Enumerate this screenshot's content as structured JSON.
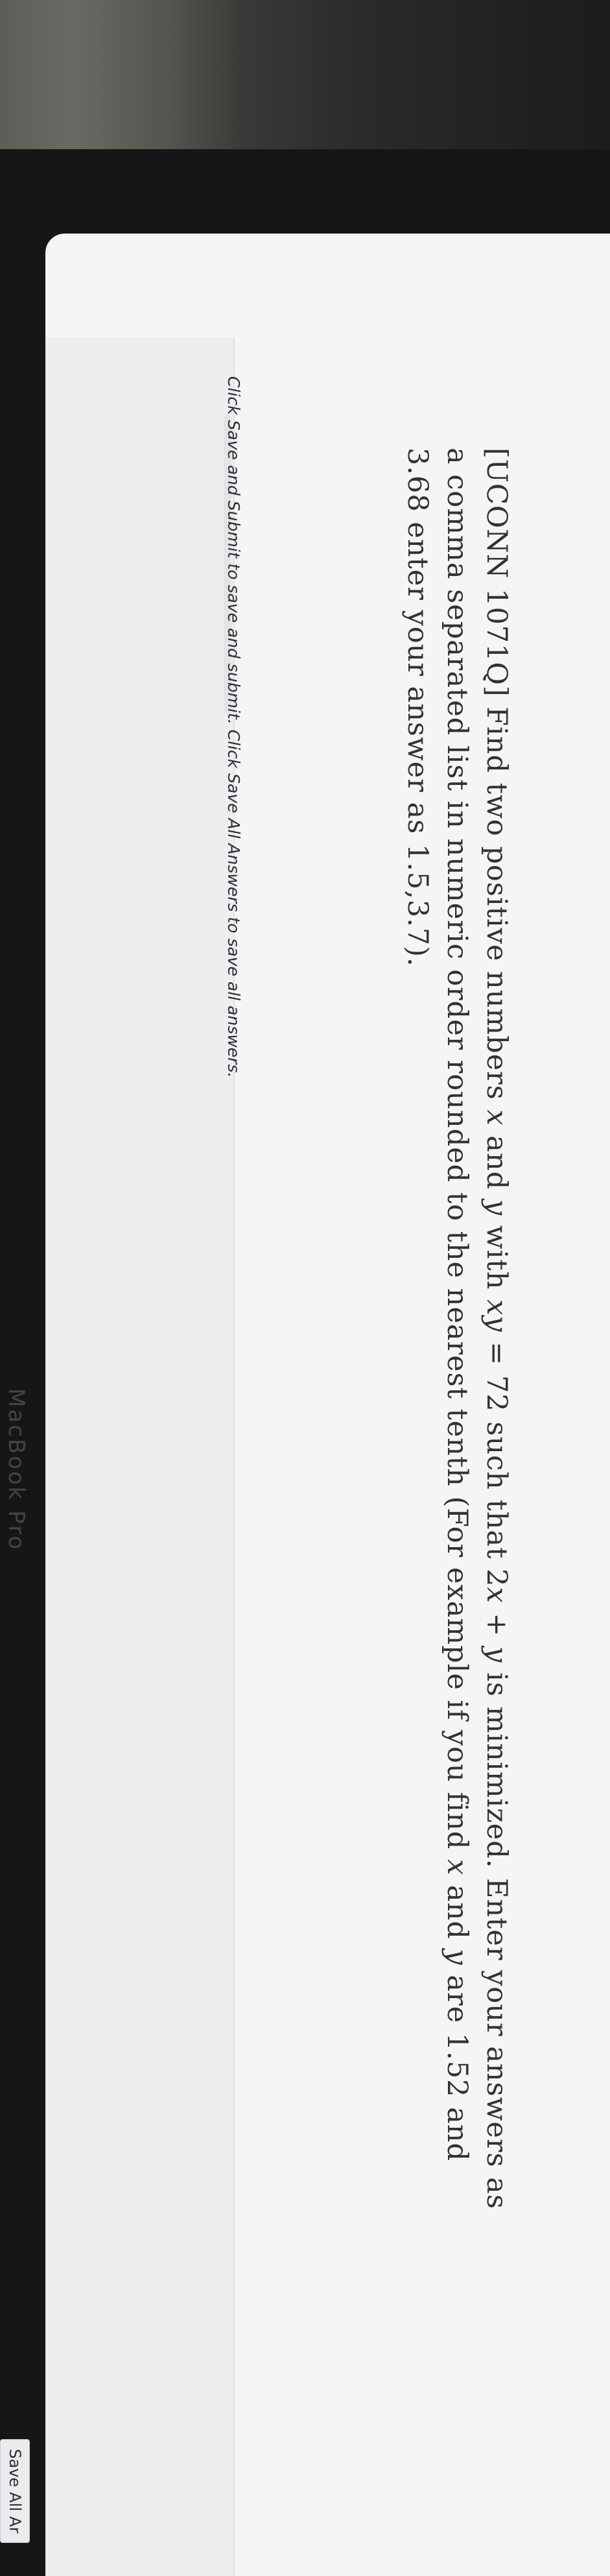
{
  "problem": {
    "prefix": "[UCONN 1071Q] Find two positive numbers ",
    "var_x": "x",
    "and_1": " and ",
    "var_y": "y",
    "with": " with ",
    "var_xy": "xy",
    "eq72": " = 72 such that 2",
    "var_x2": "x",
    "plus": " + ",
    "var_y2": "y",
    "rest_1": " is minimized. Enter your answers as a comma separated list in numeric order rounded to the nearest tenth (For example if you find ",
    "var_x3": "x",
    "and_2": " and ",
    "var_y3": "y",
    "rest_2": " are 1.52 and 3.68 enter your answer as 1.5,3.7)."
  },
  "instructions": "Click Save and Submit to save and submit. Click Save All Answers to save all answers.",
  "buttons": {
    "save_all": "Save All Ar"
  },
  "device_label": "MacBook Pro"
}
